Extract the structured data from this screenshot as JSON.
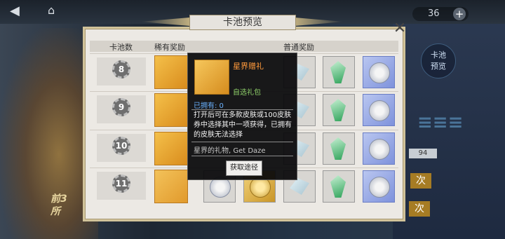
{
  "header_bar": {
    "currency_value": "36"
  },
  "side": {
    "pool_preview_label": "卡池\n预览",
    "gold_btn_1": "次",
    "gold_btn_2": "次",
    "num_label": "94"
  },
  "left_bg_text": "前3\n所",
  "modal": {
    "title": "卡池预览",
    "columns": {
      "pool_count": "卡池数",
      "rare_reward": "稀有奖励",
      "normal_reward": "普通奖励"
    },
    "rows": [
      {
        "number": "8"
      },
      {
        "number": "9"
      },
      {
        "number": "10"
      },
      {
        "number": "11"
      }
    ]
  },
  "tooltip": {
    "item_name": "星界赠礼",
    "item_type": "自选礼包",
    "owned": "已拥有: 0",
    "description": "打开后可在多款皮肤或100皮肤券中选择其中一项获得，已拥有的皮肤无法选择",
    "flavor": "星界的礼物, Get Daze",
    "source_button": "获取途径"
  },
  "colors": {
    "item_name": "#ff9a3c",
    "item_type": "#8fd16a",
    "owned": "#6ab2ff",
    "rare_bg": "#f4c04a"
  }
}
